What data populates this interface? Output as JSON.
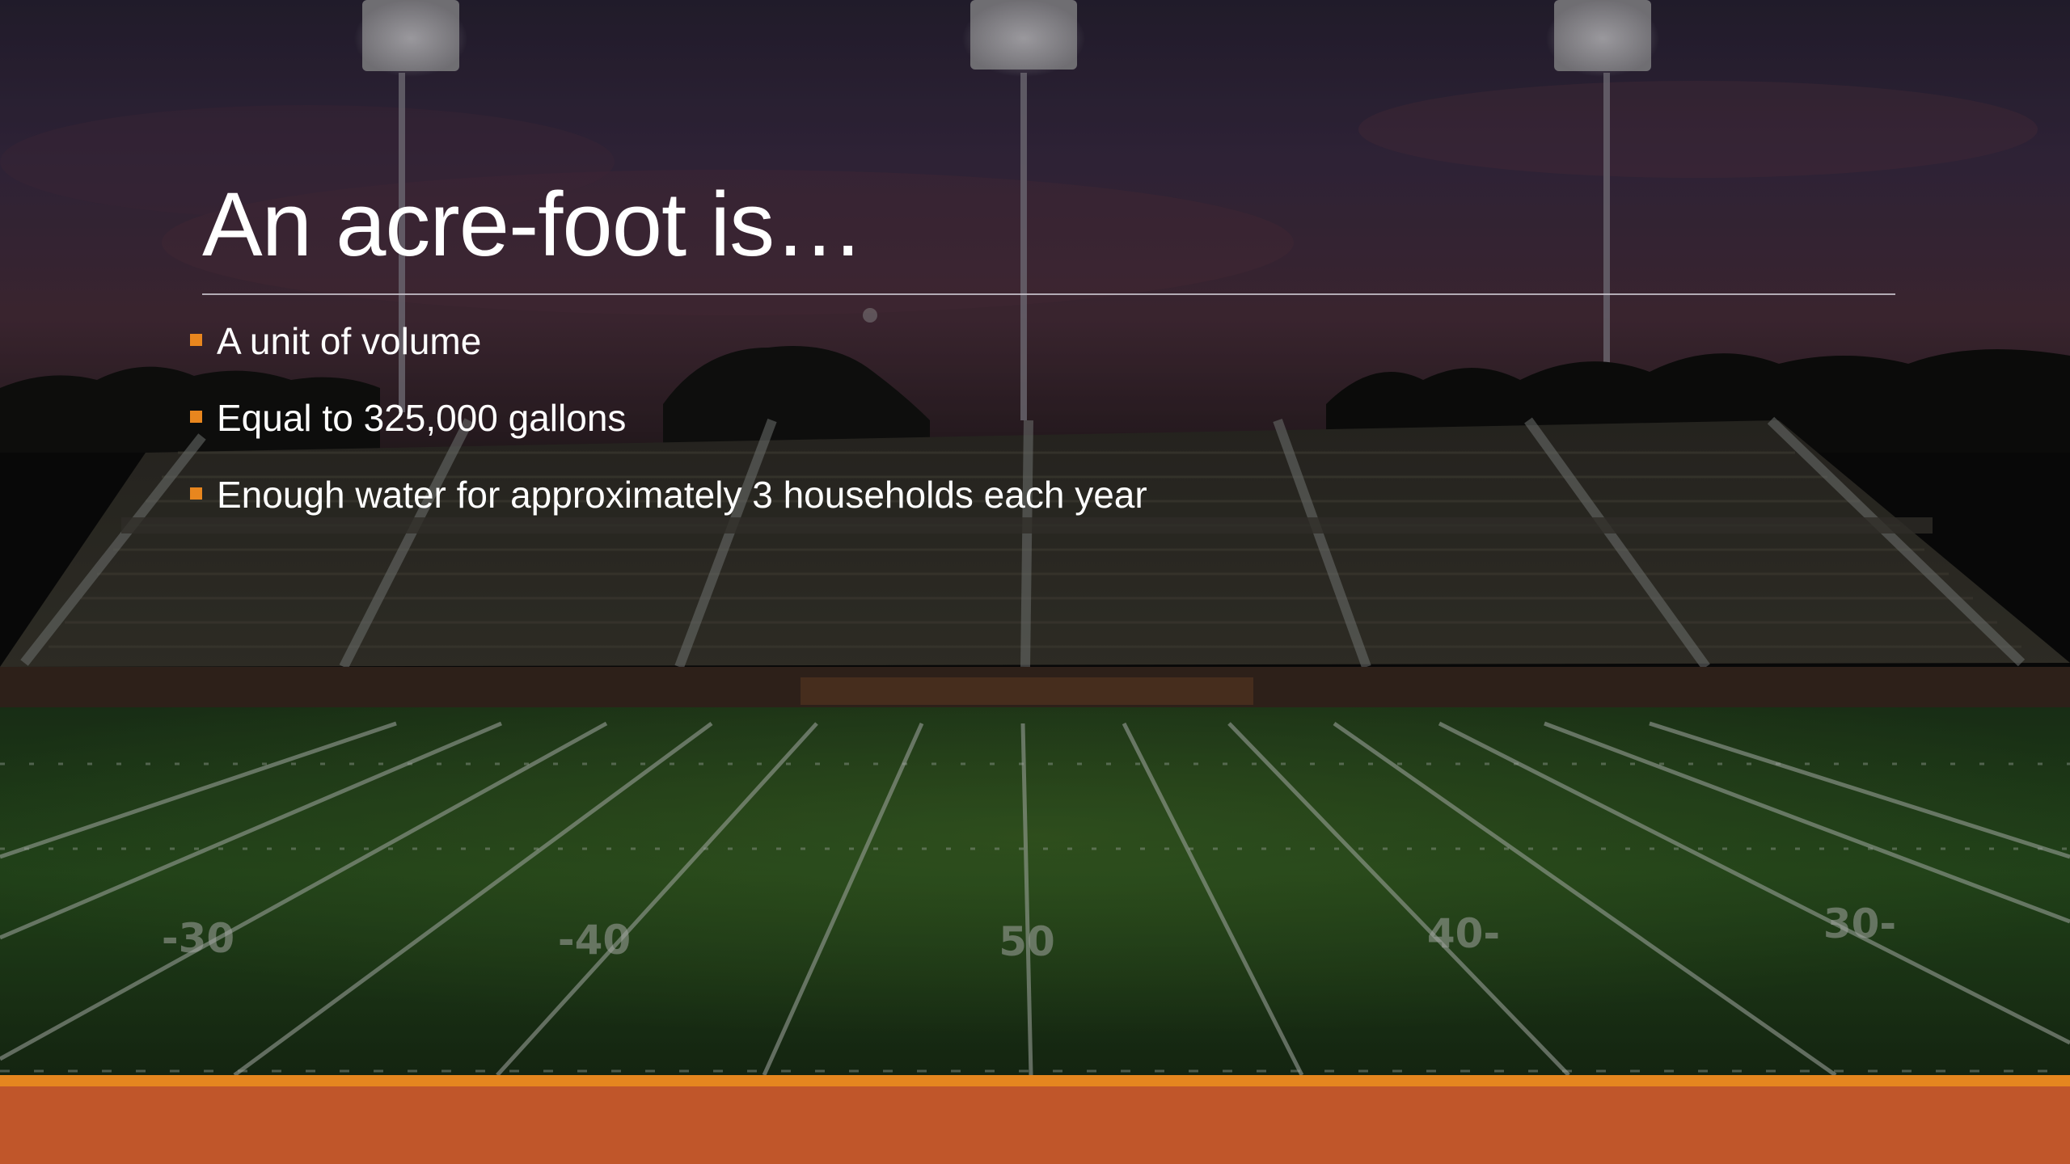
{
  "slide": {
    "title": "An acre-foot is…",
    "bullets": [
      "A unit of volume",
      "Equal to 325,000 gallons",
      "Enough water for approximately 3 households each year"
    ]
  },
  "background": {
    "description_icon": "football-stadium-photo",
    "field_numbers": [
      "-30",
      "-40",
      "50",
      "40-",
      "30-"
    ]
  },
  "colors": {
    "accent_orange": "#e8861e",
    "bottom_band": "#c0562a",
    "bottom_band_stripe": "#e5861f",
    "title_text": "#ffffff",
    "rule": "#c9c4cc"
  }
}
